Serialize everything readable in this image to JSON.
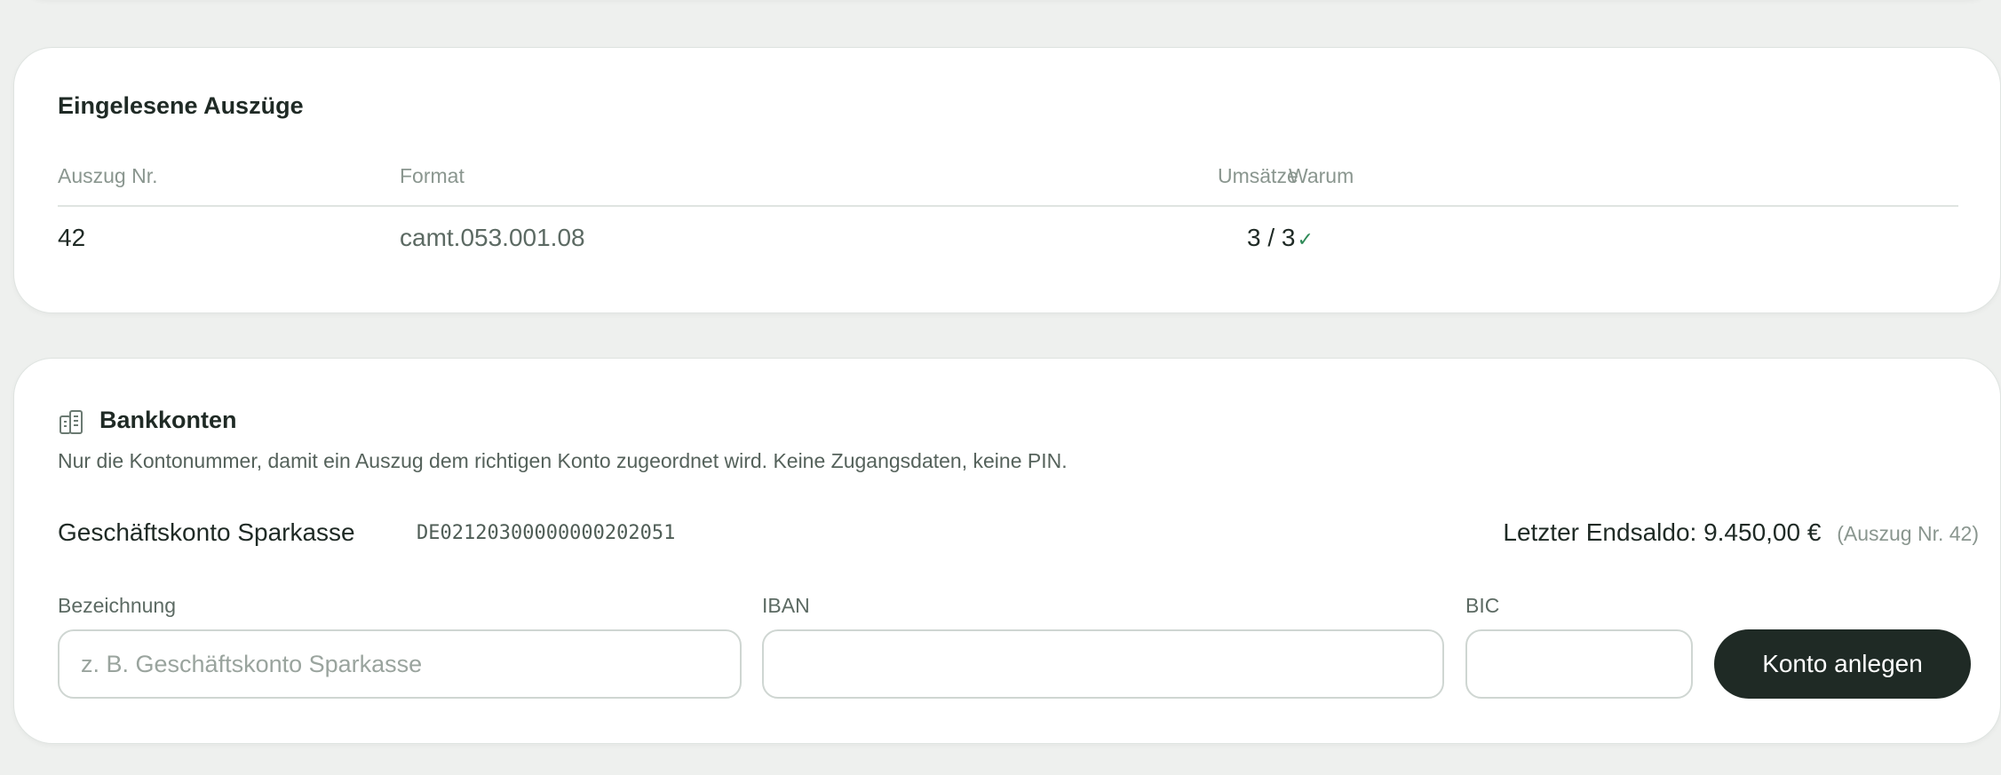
{
  "auszuege": {
    "title": "Eingelesene Auszüge",
    "columns": {
      "nr": "Auszug Nr.",
      "format": "Format",
      "umsaetze": "Umsätze",
      "warum": "Warum"
    },
    "rows": [
      {
        "nr": "42",
        "format": "camt.053.001.08",
        "umsaetze": "3 / 3",
        "status_icon": "check-icon",
        "status_glyph": "✓"
      }
    ]
  },
  "bank": {
    "icon": "bank-building-icon",
    "title": "Bankkonten",
    "subtitle": "Nur die Kontonummer, damit ein Auszug dem richtigen Konto zugeordnet wird. Keine Zugangsdaten, keine PIN.",
    "accounts": [
      {
        "name": "Geschäftskonto Sparkasse",
        "iban": "DE02120300000000202051",
        "saldo_label": "Letzter Endsaldo:",
        "saldo_value": "9.450,00 €",
        "saldo_ref": "(Auszug Nr. 42)"
      }
    ],
    "form": {
      "bezeichnung_label": "Bezeichnung",
      "bezeichnung_placeholder": "z. B. Geschäftskonto Sparkasse",
      "bezeichnung_value": "",
      "iban_label": "IBAN",
      "iban_value": "",
      "bic_label": "BIC",
      "bic_value": "",
      "submit_label": "Konto anlegen"
    }
  },
  "colors": {
    "background": "#eef0ee",
    "card": "#ffffff",
    "text": "#1f2a25",
    "muted": "#8a968f",
    "accent_check": "#2e8a57",
    "button": "#1f2a25"
  }
}
